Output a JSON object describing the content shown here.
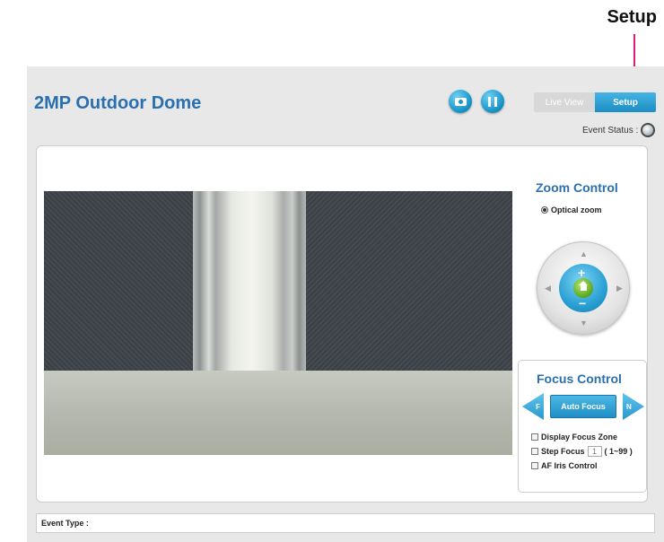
{
  "annotation": {
    "label": "Setup"
  },
  "header": {
    "title": "2MP Outdoor Dome"
  },
  "toolbar": {
    "snapshot_icon": "camera-icon",
    "pause_icon": "pause-icon"
  },
  "tabs": {
    "live_view": "Live View",
    "setup": "Setup"
  },
  "event_status": {
    "label": "Event Status :"
  },
  "zoom_control": {
    "title": "Zoom Control",
    "mode": "Optical zoom",
    "plus": "+",
    "minus": "−",
    "arrows": {
      "up": "▲",
      "down": "▼",
      "left": "◀",
      "right": "▶"
    }
  },
  "focus_control": {
    "title": "Focus Control",
    "far_label": "F",
    "near_label": "N",
    "auto_focus_label": "Auto Focus",
    "display_focus_zone": "Display Focus Zone",
    "step_focus_label": "Step Focus",
    "step_focus_value": "1",
    "step_focus_range": "( 1~99 )",
    "af_iris_control": "AF Iris Control"
  },
  "footer": {
    "event_type_label": "Event Type :"
  },
  "colors": {
    "accent": "#2a6fb0",
    "button_blue": "#1995c8",
    "annotation": "#e0197d"
  }
}
